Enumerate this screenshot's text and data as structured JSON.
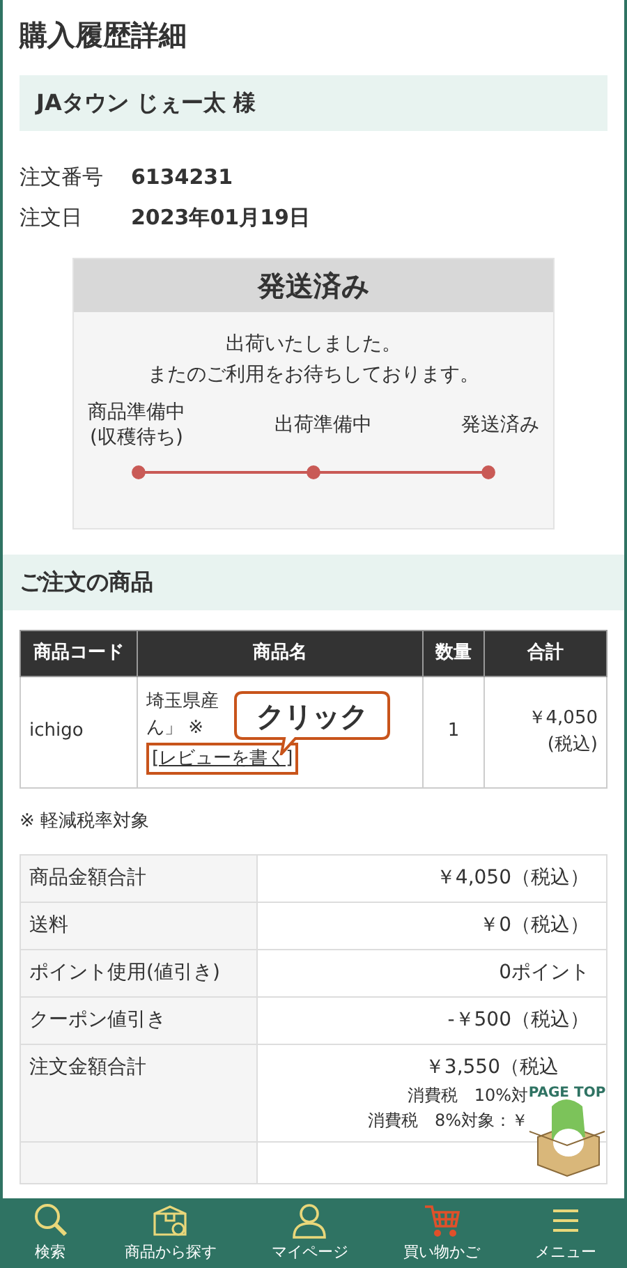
{
  "page_title": "購入履歴詳細",
  "customer": {
    "name": "JAタウン じぇー太 様"
  },
  "order_info": [
    {
      "label": "注文番号",
      "value": "6134231"
    },
    {
      "label": "注文日",
      "value": "2023年01月19日"
    }
  ],
  "status": {
    "heading": "発送済み",
    "message": [
      "出荷いたしました。",
      "またのご利用をお待ちしております。"
    ],
    "steps": [
      {
        "label": "商品準備中\n(収穫待ち)",
        "done": true
      },
      {
        "label": "出荷準備中",
        "done": true
      },
      {
        "label": "発送済み",
        "done": true
      }
    ]
  },
  "items_section": {
    "title": "ご注文の商品",
    "columns": [
      "商品コード",
      "商品名",
      "数量",
      "合計"
    ],
    "rows": [
      {
        "code": "ichigo",
        "name_lines": [
          "埼玉県産",
          "ん」 ※"
        ],
        "review_link": "[レビューを書く]",
        "quantity": "1",
        "total": "￥4,050\n(税込)"
      }
    ],
    "callout": "クリック"
  },
  "note": "※ 軽減税率対象",
  "summary": [
    {
      "label": "商品金額合計",
      "value": "￥4,050（税込）"
    },
    {
      "label": "送料",
      "value": "￥0（税込）"
    },
    {
      "label": "ポイント使用(値引き)",
      "value": "0ポイント"
    },
    {
      "label": "クーポン値引き",
      "value": "-￥500（税込）"
    },
    {
      "label": "注文金額合計",
      "value": "￥3,550（税込",
      "sub": [
        "消費税　10%対",
        "消費税　8%対象：￥"
      ]
    }
  ],
  "page_top": {
    "label": "PAGE TOP"
  },
  "bottom_nav": [
    {
      "label": "検索",
      "kind": "search",
      "color": "#e9d77a"
    },
    {
      "label": "商品から探す",
      "kind": "box",
      "color": "#e9d77a"
    },
    {
      "label": "マイページ",
      "kind": "person",
      "color": "#e9d77a"
    },
    {
      "label": "買い物かご",
      "kind": "cart",
      "color": "#e0502a"
    },
    {
      "label": "メニュー",
      "kind": "menu",
      "color": "#e9d77a"
    }
  ]
}
